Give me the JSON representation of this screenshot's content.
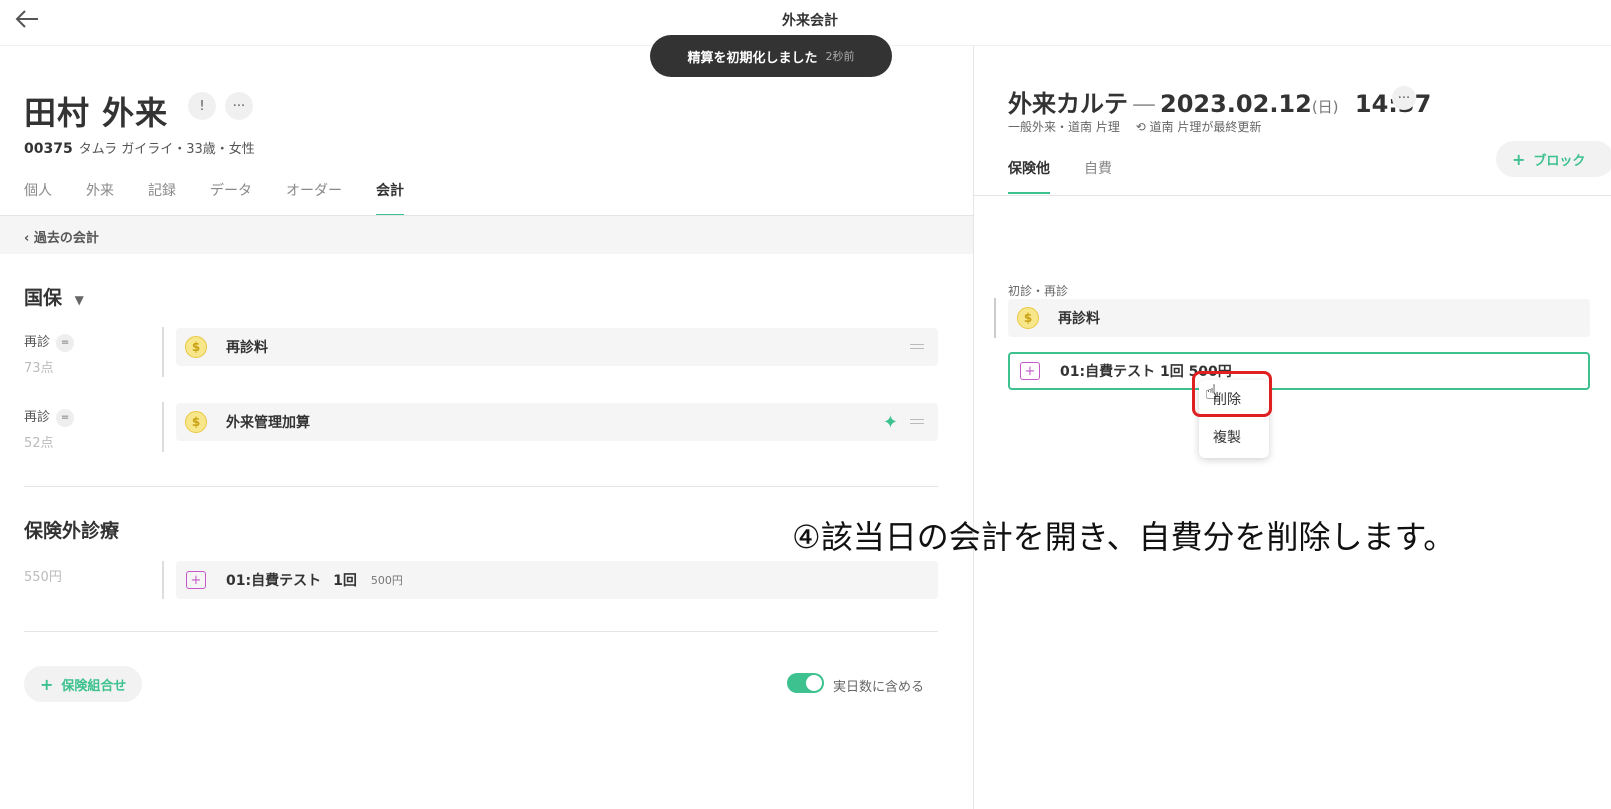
{
  "header": {
    "title": "外来会計"
  },
  "toast": {
    "message": "精算を初期化しました",
    "time": "2秒前"
  },
  "patient": {
    "name": "田村 外来",
    "id": "00375",
    "details": "タムラ ガイライ・33歳・女性"
  },
  "tabs": [
    "個人",
    "外来",
    "記録",
    "データ",
    "オーダー",
    "会計"
  ],
  "active_tab": "会計",
  "past_link": "過去の会計",
  "insurance": {
    "type": "国保",
    "items": [
      {
        "kind": "再診",
        "points": "73点",
        "name": "再診料",
        "icon": "coin-icon"
      },
      {
        "kind": "再診",
        "points": "52点",
        "name": "外来管理加算",
        "icon": "coin-icon"
      }
    ]
  },
  "non_insured": {
    "title": "保険外診療",
    "amount": "550円",
    "item": {
      "name": "01:自費テスト",
      "qty": "1回",
      "price": "500円",
      "icon": "medical-box-icon"
    }
  },
  "add_combo_label": "保険組合せ",
  "toggle": {
    "label": "実日数に含める",
    "on": true
  },
  "chart": {
    "title": "外来カルテ",
    "dash": "—",
    "date": "2023.02.12",
    "dow": "(日)",
    "time": "14:37",
    "meta_left": "一般外来・道南 片理",
    "meta_right": "道南 片理が最終更新",
    "tabs": [
      "保険他",
      "自費"
    ],
    "active_tab": "保険他",
    "block_label": "ブロック",
    "section": "初診・再診",
    "items": [
      {
        "name": "再診料",
        "icon": "coin-icon"
      },
      {
        "name": "01:自費テスト 1回 500円",
        "icon": "medical-box-icon"
      }
    ]
  },
  "context_menu": [
    "削除",
    "複製"
  ],
  "annotation": "④該当日の会計を開き、自費分を削除します。",
  "colors": {
    "accent": "#3cc18f",
    "highlight": "#e02020",
    "toast_bg": "#333333"
  }
}
